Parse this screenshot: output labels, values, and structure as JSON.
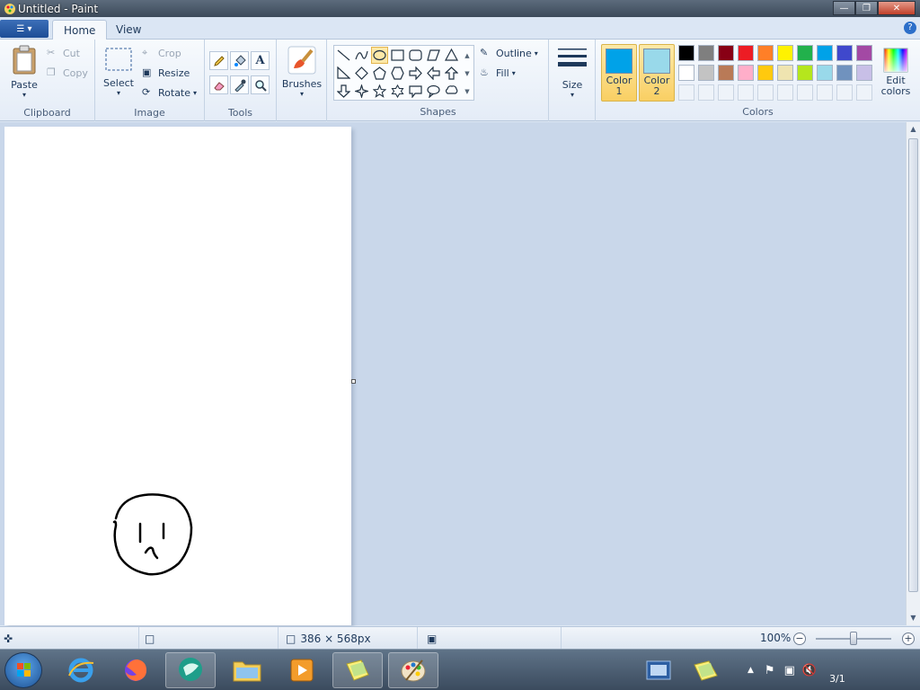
{
  "window": {
    "title": "Untitled - Paint"
  },
  "tabs": [
    {
      "label": "Home"
    },
    {
      "label": "View"
    }
  ],
  "ribbon": {
    "clipboard": {
      "label": "Clipboard",
      "paste": "Paste",
      "cut": "Cut",
      "copy": "Copy"
    },
    "image": {
      "label": "Image",
      "select": "Select",
      "crop": "Crop",
      "resize": "Resize",
      "rotate": "Rotate"
    },
    "tools": {
      "label": "Tools"
    },
    "brushes": {
      "label": "Brushes"
    },
    "shapes": {
      "label": "Shapes",
      "outline": "Outline",
      "fill": "Fill"
    },
    "size": {
      "label": "Size"
    },
    "colors": {
      "label": "Colors",
      "color1_label": "Color\n1",
      "color2_label": "Color\n2",
      "color1": "#00a2e8",
      "color2": "#99d9ea",
      "edit": "Edit colors",
      "palette_row1": [
        "#000000",
        "#7f7f7f",
        "#880015",
        "#ed1c24",
        "#ff7f27",
        "#fff200",
        "#22b14c",
        "#00a2e8",
        "#3f48cc",
        "#a349a4"
      ],
      "palette_row2": [
        "#ffffff",
        "#c3c3c3",
        "#b97a57",
        "#ffaec9",
        "#ffc90e",
        "#efe4b0",
        "#b5e61d",
        "#99d9ea",
        "#7092be",
        "#c8bfe7"
      ]
    }
  },
  "status": {
    "canvas_size": "386 × 568px",
    "zoom": "100%"
  },
  "taskbar": {
    "date": "3/1"
  }
}
